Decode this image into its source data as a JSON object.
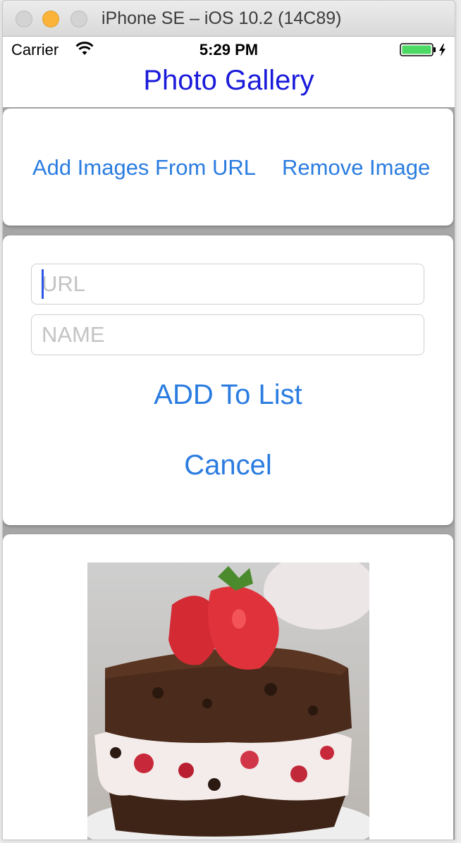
{
  "window": {
    "title": "iPhone SE – iOS 10.2 (14C89)"
  },
  "status_bar": {
    "carrier": "Carrier",
    "time": "5:29 PM",
    "battery_color": "#4cd964"
  },
  "nav": {
    "title": "Photo Gallery"
  },
  "actions": {
    "add_from_url": "Add Images From URL",
    "remove_image": "Remove Image"
  },
  "form": {
    "url_placeholder": "URL",
    "name_placeholder": "NAME",
    "add_to_list": "ADD To List",
    "cancel": "Cancel"
  },
  "gallery": {
    "image_subject": "strawberry-brownie-dessert"
  },
  "colors": {
    "nav_title": "#1a1adb",
    "link": "#2a7ce0",
    "background": "#a7a7a7"
  }
}
